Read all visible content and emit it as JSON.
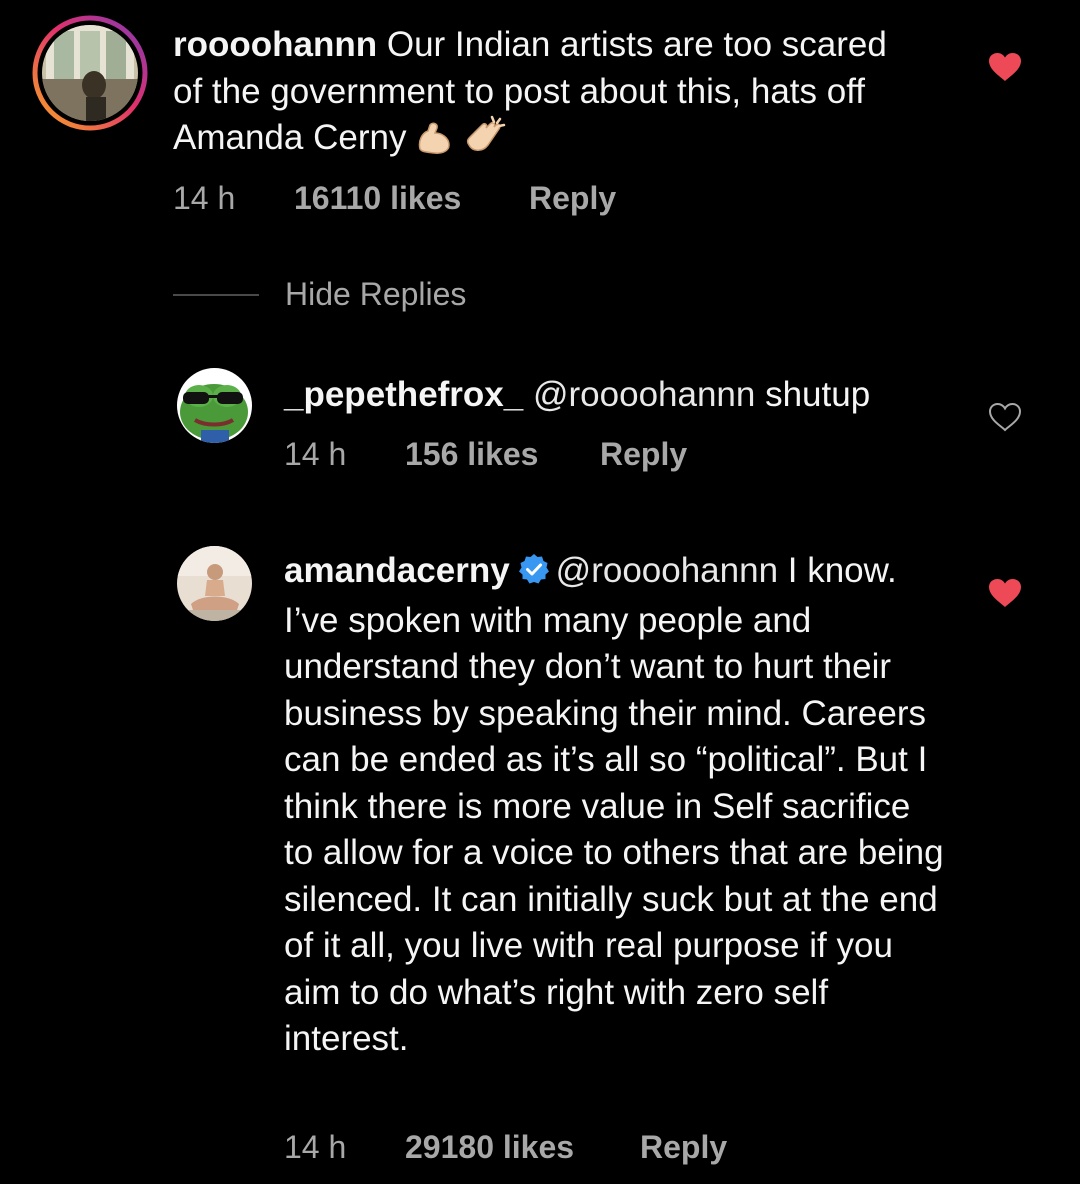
{
  "comments": [
    {
      "username": "roooohannn",
      "text": " Our Indian artists are too scared of the government to post about this, hats off Amanda Cerny",
      "emojis": [
        "flexed-biceps",
        "clapping-hands"
      ],
      "time": "14 h",
      "likes": "16110 likes",
      "reply_label": "Reply",
      "liked": true
    }
  ],
  "hide_replies_label": "Hide Replies",
  "replies": [
    {
      "username": "_pepethefrox_",
      "mention": "@roooohannn",
      "text": " shutup",
      "time": "14 h",
      "likes": "156 likes",
      "reply_label": "Reply",
      "liked": false
    },
    {
      "username": "amandacerny",
      "verified": true,
      "mention": "@roooohannn",
      "text": " I know. I’ve spoken with many people and understand they don’t want to hurt their business by speaking their mind. Careers can be ended as it’s all so “political”. But I think there is more value in Self sacrifice to allow for a voice to others that are being silenced. It can initially suck but at the end of it all, you live with real purpose if you aim to do what’s right with zero self interest.",
      "time": "14 h",
      "likes": "29180 likes",
      "reply_label": "Reply",
      "liked": true
    }
  ],
  "colors": {
    "background": "#000000",
    "heart_liked": "#ed4956",
    "meta_text": "#a8a8a8",
    "verified": "#3897f0",
    "story_ring": [
      "#f9a825",
      "#e1306c",
      "#833ab4"
    ]
  }
}
